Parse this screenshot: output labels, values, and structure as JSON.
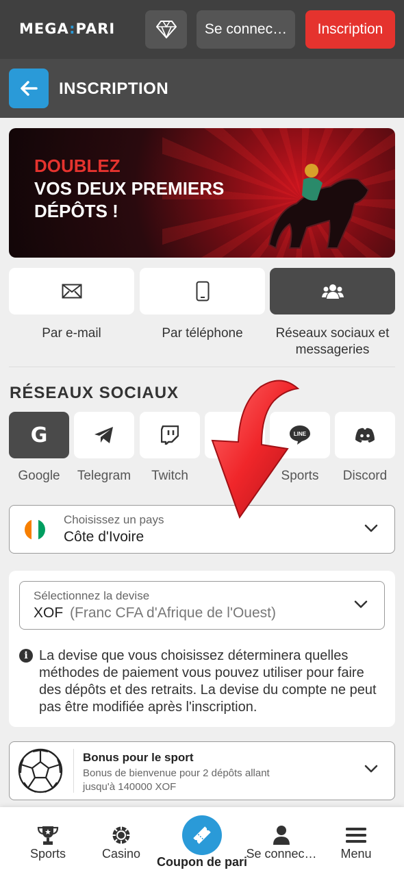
{
  "header": {
    "logo_left": "MEGA",
    "logo_sep": ":",
    "logo_right": "PARI",
    "login_label": "Se connec…",
    "register_label": "Inscription",
    "gem_icon": "diamond-icon"
  },
  "page": {
    "title": "INSCRIPTION"
  },
  "banner": {
    "line1": "DOUBLEZ",
    "line2": "VOS DEUX PREMIERS DÉPÔTS !"
  },
  "methods": [
    {
      "label": "Par e-mail",
      "icon": "envelope-icon"
    },
    {
      "label": "Par téléphone",
      "icon": "phone-icon"
    },
    {
      "label": "Réseaux sociaux et messageries",
      "icon": "users-icon"
    }
  ],
  "social_section": {
    "title": "RÉSEAUX SOCIAUX",
    "items": [
      {
        "label": "Google",
        "icon": "google-icon"
      },
      {
        "label": "Telegram",
        "icon": "telegram-icon"
      },
      {
        "label": "Twitch",
        "icon": "twitch-icon"
      },
      {
        "label": "",
        "icon": "hidden-icon"
      },
      {
        "label": "Sports",
        "icon": "line-icon"
      },
      {
        "label": "Discord",
        "icon": "discord-icon"
      }
    ]
  },
  "country": {
    "label": "Choisissez un pays",
    "value": "Côte d'Ivoire",
    "flag_colors": [
      "#f77f00",
      "#ffffff",
      "#009e60"
    ]
  },
  "currency": {
    "label": "Sélectionnez la devise",
    "code": "XOF",
    "name": "(Franc CFA d'Afrique de l'Ouest)",
    "info": "La devise que vous choisissez déterminera quelles méthodes de paiement vous pouvez utiliser pour faire des dépôts et des retraits. La devise du compte ne peut pas être modifiée après l'inscription."
  },
  "bonus": {
    "title": "Bonus pour le sport",
    "description": "Bonus de bienvenue pour 2 dépôts allant jusqu'à 140000 XOF"
  },
  "bottom_nav": {
    "sports": "Sports",
    "casino": "Casino",
    "coupon": "Coupon de pari",
    "login": "Se connec…",
    "menu": "Menu"
  },
  "colors": {
    "accent_blue": "#2a9ad8",
    "accent_red": "#e5332e",
    "header_dark": "#404040"
  }
}
